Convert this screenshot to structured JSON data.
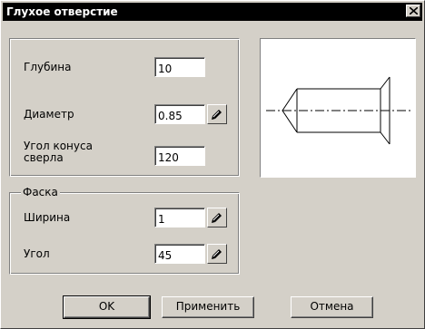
{
  "window": {
    "title": "Глухое отверстие",
    "close_label": "×"
  },
  "params": {
    "depth_label": "Глубина",
    "depth_value": "10",
    "diameter_label": "Диаметр",
    "diameter_value": "0.85",
    "cone_angle_label_line1": "Угол конуса",
    "cone_angle_label_line2": "сверла",
    "cone_angle_value": "120"
  },
  "chamfer": {
    "group_label": "Фаска",
    "width_label": "Ширина",
    "width_value": "1",
    "angle_label": "Угол",
    "angle_value": "45"
  },
  "buttons": {
    "ok": "OK",
    "apply": "Применить",
    "cancel": "Отмена"
  },
  "icons": {
    "pick": "pencil-pick-icon",
    "close": "close-icon"
  }
}
